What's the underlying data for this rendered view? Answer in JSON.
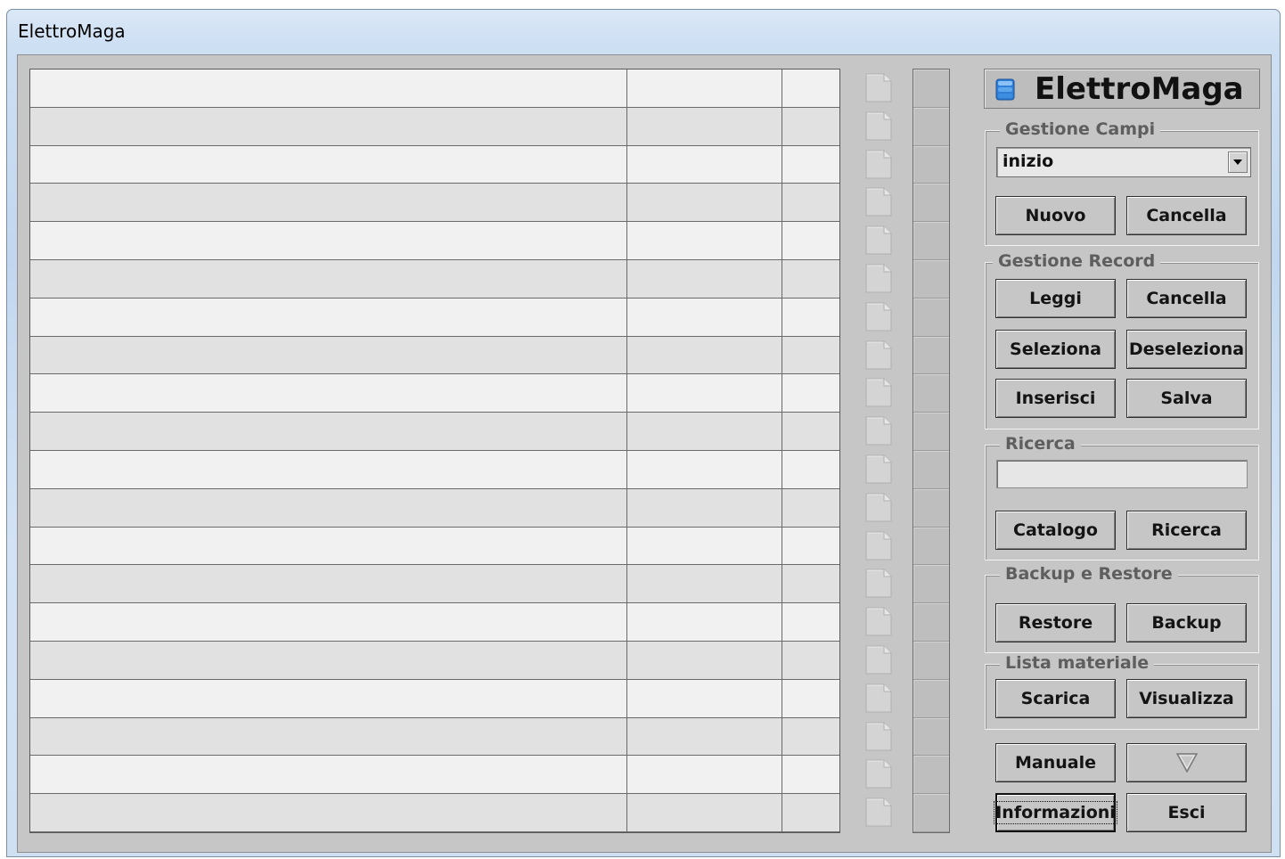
{
  "window": {
    "title": "ElettroMaga"
  },
  "logo": {
    "text": "ElettroMaga"
  },
  "gestione_campi": {
    "label": "Gestione Campi",
    "combo_value": "inizio",
    "nuovo": "Nuovo",
    "cancella": "Cancella"
  },
  "gestione_record": {
    "label": "Gestione Record",
    "leggi": "Leggi",
    "cancella": "Cancella",
    "seleziona": "Seleziona",
    "deseleziona": "Deseleziona",
    "inserisci": "Inserisci",
    "salva": "Salva"
  },
  "ricerca": {
    "label": "Ricerca",
    "input_value": "",
    "catalogo": "Catalogo",
    "ricerca": "Ricerca"
  },
  "backup_restore": {
    "label": "Backup e Restore",
    "restore": "Restore",
    "backup": "Backup"
  },
  "lista_materiale": {
    "label": "Lista materiale",
    "scarica": "Scarica",
    "visualizza": "Visualizza"
  },
  "footer": {
    "manuale": "Manuale",
    "down_icon": "triangle-down-icon",
    "informazioni": "Informazioni",
    "esci": "Esci"
  },
  "grid": {
    "row_count": 20,
    "rows": [
      [
        "",
        "",
        ""
      ],
      [
        "",
        "",
        ""
      ],
      [
        "",
        "",
        ""
      ],
      [
        "",
        "",
        ""
      ],
      [
        "",
        "",
        ""
      ],
      [
        "",
        "",
        ""
      ],
      [
        "",
        "",
        ""
      ],
      [
        "",
        "",
        ""
      ],
      [
        "",
        "",
        ""
      ],
      [
        "",
        "",
        ""
      ],
      [
        "",
        "",
        ""
      ],
      [
        "",
        "",
        ""
      ],
      [
        "",
        "",
        ""
      ],
      [
        "",
        "",
        ""
      ],
      [
        "",
        "",
        ""
      ],
      [
        "",
        "",
        ""
      ],
      [
        "",
        "",
        ""
      ],
      [
        "",
        "",
        ""
      ],
      [
        "",
        "",
        ""
      ],
      [
        "",
        "",
        ""
      ]
    ]
  },
  "icons": {
    "row_doc": "document-icon",
    "logo": "database-icon"
  }
}
